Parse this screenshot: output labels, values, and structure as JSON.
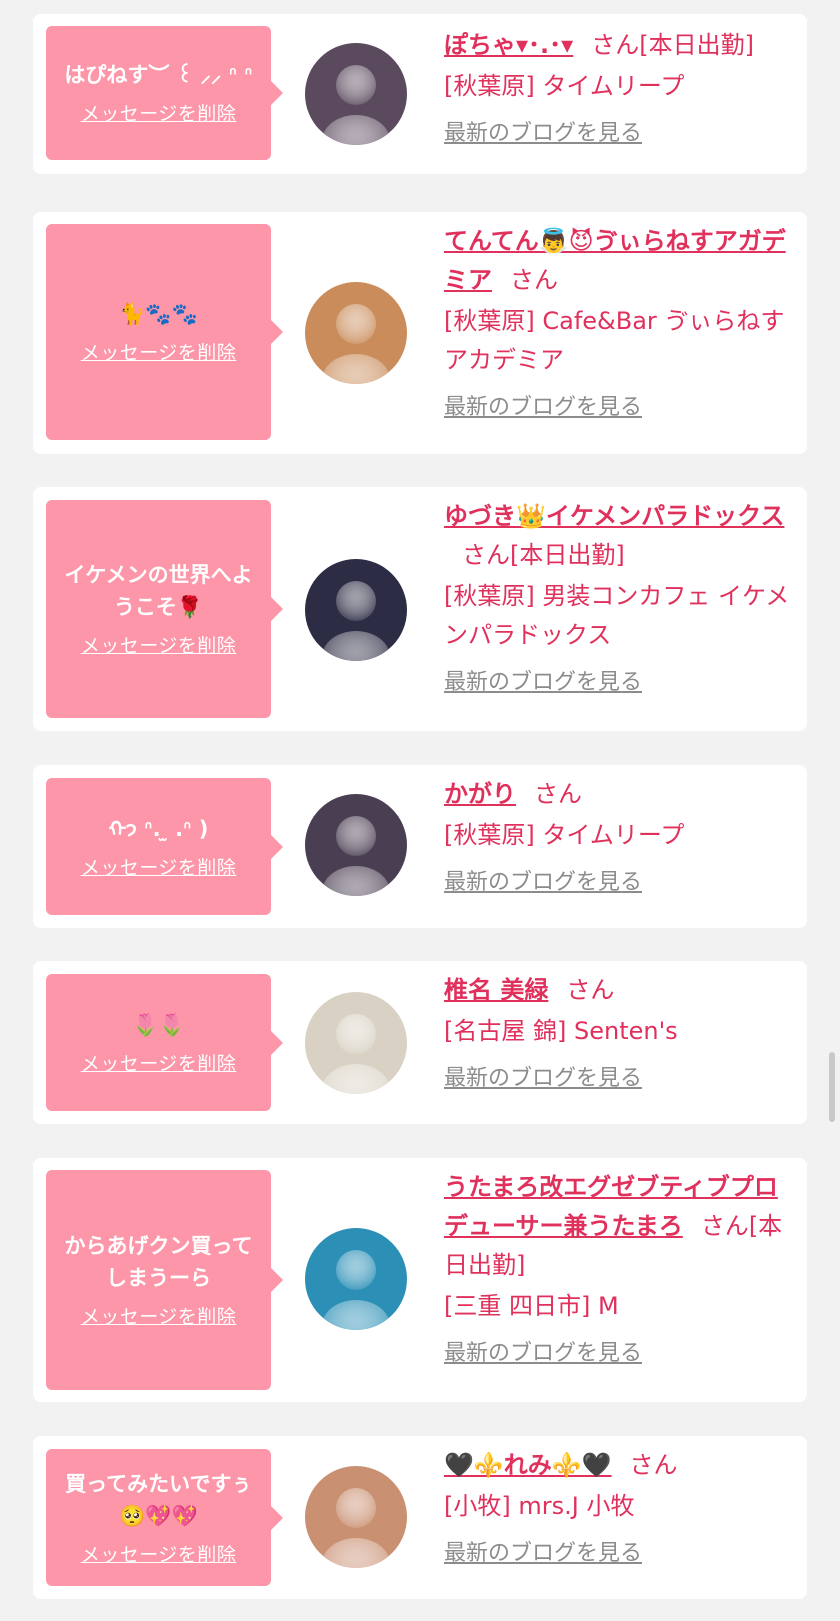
{
  "favorites": [
    {
      "message": "はぴねす︶ ꒰ ⸝⸝ ᐢ ᐢ",
      "delete_label": "メッセージを削除",
      "name": "ぽちゃ▾･.･▾",
      "honorific": "さん",
      "status": "[本日出勤]",
      "shop": "[秋葉原] タイムリープ",
      "blog_label": "最新のブログを見る",
      "avatar_color": "#5b4a5e"
    },
    {
      "message": "🐈🐾🐾",
      "delete_label": "メッセージを削除",
      "name": "てんてん👼😈ゔぃらねすアガデミア",
      "honorific": "さん",
      "status": "",
      "shop": "[秋葉原] Cafe&Bar ゔぃらねすアカデミア",
      "blog_label": "最新のブログを見る",
      "avatar_color": "#c98c5a"
    },
    {
      "message": "イケメンの世界へようこそ🌹",
      "delete_label": "メッセージを削除",
      "name": "ゆづき👑イケメンパラドックス",
      "honorific": "さん",
      "status": "[本日出勤]",
      "shop": "[秋葉原] 男装コンカフェ イケメンパラドックス",
      "blog_label": "最新のブログを見る",
      "avatar_color": "#2c2c44"
    },
    {
      "message": "ᡣ𐭩 ᐢ. ̫ .ᐢ )",
      "delete_label": "メッセージを削除",
      "name": "かがり",
      "honorific": "さん",
      "status": "",
      "shop": "[秋葉原] タイムリープ",
      "blog_label": "最新のブログを見る",
      "avatar_color": "#4a3f52"
    },
    {
      "message": "🌷🌷",
      "delete_label": "メッセージを削除",
      "name": "椎名 美緑",
      "honorific": "さん",
      "status": "",
      "shop": "[名古屋 錦] Senten's",
      "blog_label": "最新のブログを見る",
      "avatar_color": "#d9d2c4"
    },
    {
      "message": "からあげクン買ってしまうーら",
      "delete_label": "メッセージを削除",
      "name": "うたまろ改エグゼブティブプロデューサー兼うたまろ",
      "honorific": "さん",
      "status": "[本日出勤]",
      "shop": "[三重 四日市] M",
      "blog_label": "最新のブログを見る",
      "avatar_color": "#2b8fb6"
    },
    {
      "message": "買ってみたいですぅ🥺💖💖",
      "delete_label": "メッセージを削除",
      "name": "🖤⚜️れみ⚜️🖤",
      "honorific": "さん",
      "status": "",
      "shop": "[小牧] mrs.J 小牧",
      "blog_label": "最新のブログを見る",
      "avatar_color": "#c99072"
    }
  ]
}
